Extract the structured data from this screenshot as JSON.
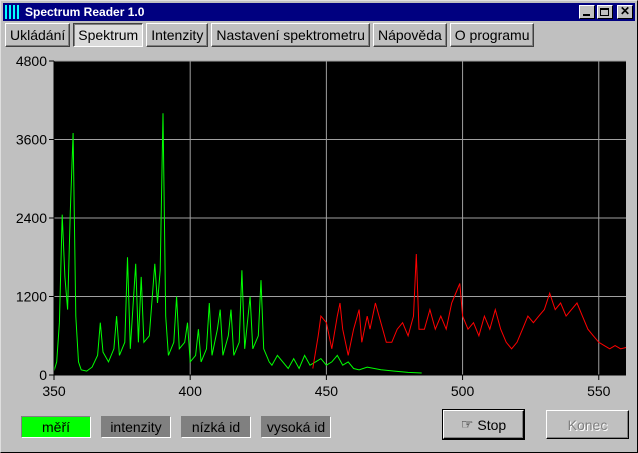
{
  "window": {
    "title": "Spectrum Reader 1.0"
  },
  "tabs": [
    {
      "label": "Ukládání"
    },
    {
      "label": "Spektrum",
      "active": true
    },
    {
      "label": "Intenzity"
    },
    {
      "label": "Nastavení spektrometru"
    },
    {
      "label": "Nápověda"
    },
    {
      "label": "O programu"
    }
  ],
  "status": {
    "measuring": {
      "label": "měří",
      "color": "#00ff00"
    },
    "intensities": {
      "label": "intenzity",
      "color": "#808080"
    },
    "low": {
      "label": "nízká id",
      "color": "#808080"
    },
    "high": {
      "label": "vysoká id",
      "color": "#808080"
    }
  },
  "buttons": {
    "stop_label": "Stop",
    "end_label": "Konec"
  },
  "colors": {
    "plot_bg": "#000000",
    "grid": "#a0a0a0",
    "series_green": "#00ff00",
    "series_red": "#ff0000"
  },
  "chart_data": {
    "type": "line",
    "xlim": [
      350,
      560
    ],
    "ylim": [
      0,
      4800
    ],
    "x_ticks": [
      350,
      400,
      450,
      500,
      550
    ],
    "y_ticks": [
      0,
      1200,
      2400,
      3600,
      4800
    ],
    "grid": true,
    "series": [
      {
        "color": "#00ff00",
        "points": [
          [
            350,
            60
          ],
          [
            351,
            200
          ],
          [
            352,
            800
          ],
          [
            353,
            2450
          ],
          [
            354,
            1500
          ],
          [
            355,
            1000
          ],
          [
            356,
            2500
          ],
          [
            357,
            3700
          ],
          [
            358,
            900
          ],
          [
            359,
            200
          ],
          [
            360,
            80
          ],
          [
            362,
            60
          ],
          [
            364,
            120
          ],
          [
            366,
            300
          ],
          [
            367,
            800
          ],
          [
            368,
            350
          ],
          [
            370,
            200
          ],
          [
            372,
            400
          ],
          [
            373,
            900
          ],
          [
            374,
            300
          ],
          [
            376,
            500
          ],
          [
            377,
            1800
          ],
          [
            378,
            400
          ],
          [
            380,
            1700
          ],
          [
            381,
            500
          ],
          [
            382,
            1500
          ],
          [
            383,
            500
          ],
          [
            385,
            600
          ],
          [
            387,
            1700
          ],
          [
            388,
            1100
          ],
          [
            389,
            1600
          ],
          [
            390,
            4000
          ],
          [
            391,
            900
          ],
          [
            392,
            300
          ],
          [
            394,
            500
          ],
          [
            395,
            1200
          ],
          [
            396,
            400
          ],
          [
            398,
            500
          ],
          [
            399,
            800
          ],
          [
            400,
            200
          ],
          [
            402,
            300
          ],
          [
            403,
            700
          ],
          [
            404,
            200
          ],
          [
            406,
            400
          ],
          [
            407,
            1100
          ],
          [
            408,
            300
          ],
          [
            410,
            700
          ],
          [
            411,
            1000
          ],
          [
            412,
            300
          ],
          [
            414,
            600
          ],
          [
            415,
            1000
          ],
          [
            416,
            300
          ],
          [
            418,
            500
          ],
          [
            419,
            1600
          ],
          [
            420,
            400
          ],
          [
            422,
            1200
          ],
          [
            423,
            400
          ],
          [
            425,
            600
          ],
          [
            426,
            1450
          ],
          [
            427,
            400
          ],
          [
            428,
            300
          ],
          [
            429,
            200
          ],
          [
            430,
            150
          ],
          [
            432,
            300
          ],
          [
            434,
            200
          ],
          [
            436,
            100
          ],
          [
            438,
            250
          ],
          [
            440,
            100
          ],
          [
            442,
            300
          ],
          [
            444,
            150
          ],
          [
            446,
            200
          ],
          [
            448,
            250
          ],
          [
            450,
            150
          ],
          [
            452,
            200
          ],
          [
            454,
            300
          ],
          [
            456,
            150
          ],
          [
            458,
            200
          ],
          [
            460,
            100
          ],
          [
            462,
            80
          ],
          [
            465,
            120
          ],
          [
            470,
            80
          ],
          [
            475,
            60
          ],
          [
            480,
            40
          ],
          [
            485,
            30
          ]
        ]
      },
      {
        "color": "#ff0000",
        "points": [
          [
            445,
            100
          ],
          [
            447,
            600
          ],
          [
            448,
            900
          ],
          [
            450,
            800
          ],
          [
            452,
            400
          ],
          [
            454,
            900
          ],
          [
            455,
            1100
          ],
          [
            456,
            700
          ],
          [
            458,
            300
          ],
          [
            460,
            700
          ],
          [
            462,
            1000
          ],
          [
            463,
            500
          ],
          [
            465,
            900
          ],
          [
            466,
            700
          ],
          [
            468,
            1100
          ],
          [
            470,
            800
          ],
          [
            472,
            500
          ],
          [
            474,
            500
          ],
          [
            476,
            700
          ],
          [
            478,
            800
          ],
          [
            480,
            600
          ],
          [
            482,
            900
          ],
          [
            483,
            1850
          ],
          [
            484,
            700
          ],
          [
            486,
            700
          ],
          [
            488,
            1000
          ],
          [
            490,
            700
          ],
          [
            492,
            900
          ],
          [
            494,
            700
          ],
          [
            496,
            1100
          ],
          [
            498,
            1300
          ],
          [
            499,
            1400
          ],
          [
            500,
            900
          ],
          [
            502,
            700
          ],
          [
            504,
            800
          ],
          [
            506,
            600
          ],
          [
            508,
            900
          ],
          [
            510,
            700
          ],
          [
            512,
            1000
          ],
          [
            514,
            700
          ],
          [
            516,
            500
          ],
          [
            518,
            400
          ],
          [
            520,
            500
          ],
          [
            522,
            700
          ],
          [
            524,
            900
          ],
          [
            526,
            800
          ],
          [
            528,
            900
          ],
          [
            530,
            1000
          ],
          [
            532,
            1250
          ],
          [
            534,
            1000
          ],
          [
            536,
            1100
          ],
          [
            538,
            900
          ],
          [
            540,
            1000
          ],
          [
            542,
            1100
          ],
          [
            544,
            900
          ],
          [
            546,
            700
          ],
          [
            548,
            600
          ],
          [
            550,
            500
          ],
          [
            552,
            450
          ],
          [
            554,
            400
          ],
          [
            556,
            450
          ],
          [
            558,
            400
          ],
          [
            560,
            420
          ]
        ]
      }
    ]
  }
}
